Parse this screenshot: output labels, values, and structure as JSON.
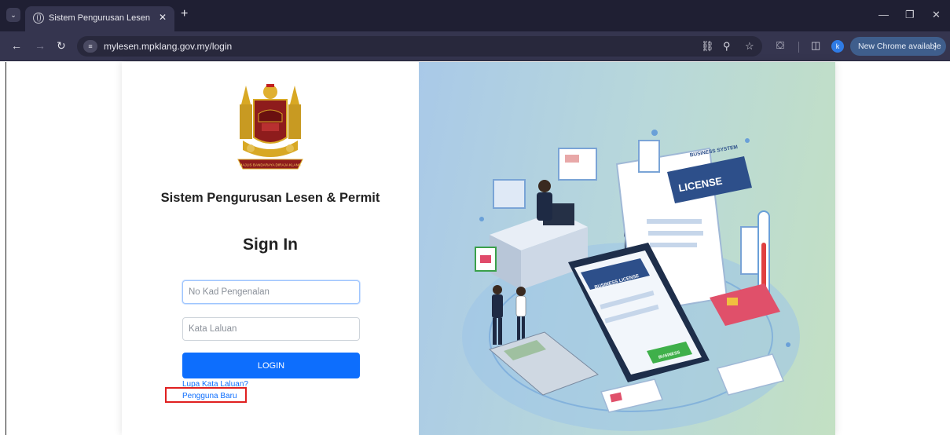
{
  "browser": {
    "tab_title": "Sistem Pengurusan Lesen & Per",
    "url": "mylesen.mpklang.gov.my/login",
    "new_chrome_label": "New Chrome available",
    "profile_initial": "k"
  },
  "page": {
    "app_title": "Sistem Pengurusan Lesen & Permit",
    "heading": "Sign In",
    "ic_placeholder": "No Kad Pengenalan",
    "password_placeholder": "Kata Laluan",
    "login_label": "LOGIN",
    "forgot_password_link": "Lupa Kata Laluan?",
    "new_user_link": "Pengguna Baru",
    "logo_banner_text": "MAJLIS BANDARAYA DIRAJA KLANG",
    "illustration_license_text": "LICENSE",
    "illustration_business_system_text": "BUSINESS SYSTEM",
    "illustration_phone_header": "BUSINESS LICENSE",
    "illustration_phone_button": "BUSINESS"
  },
  "colors": {
    "chrome_dark": "#1f1f33",
    "chrome_toolbar": "#35354f",
    "primary_button": "#0d6efd",
    "highlight_box": "#e02020"
  }
}
